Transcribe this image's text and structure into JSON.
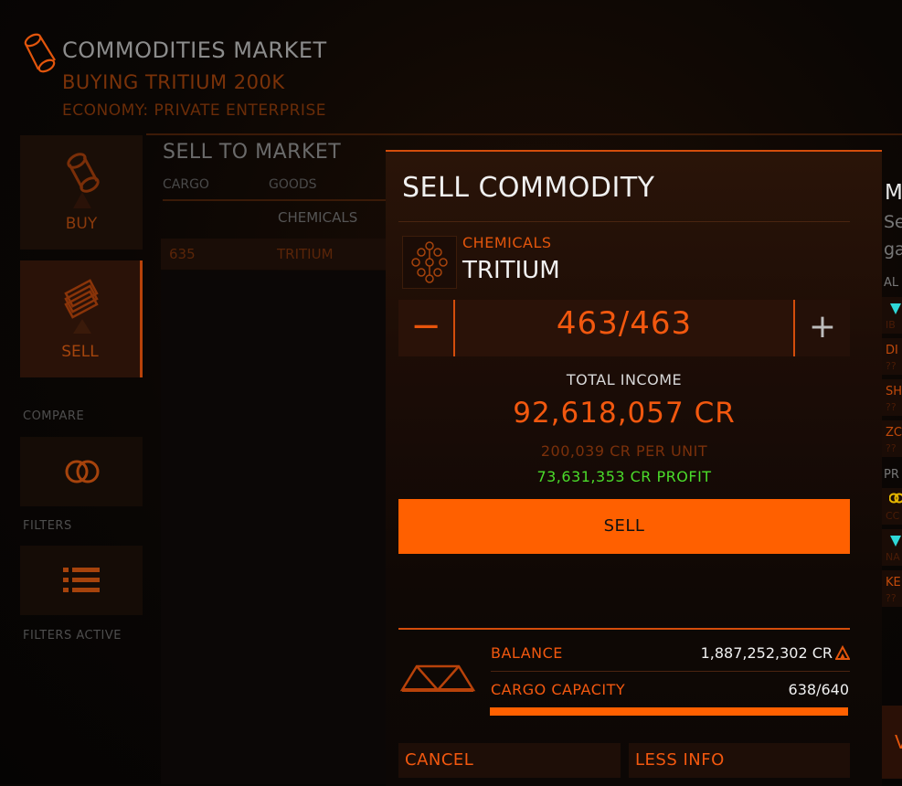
{
  "header": {
    "title": "COMMODITIES MARKET",
    "subtitle": "BUYING TRITIUM 200K",
    "economy": "ECONOMY: PRIVATE ENTERPRISE"
  },
  "nav": {
    "buy_label": "BUY",
    "sell_label": "SELL",
    "compare_caption": "COMPARE",
    "filters_caption": "FILTERS",
    "filters_active_caption": "FILTERS ACTIVE"
  },
  "market": {
    "title": "SELL TO MARKET",
    "col_cargo": "CARGO",
    "col_goods": "GOODS",
    "category": "CHEMICALS",
    "row": {
      "cargo": "635",
      "goods": "TRITIUM"
    }
  },
  "modal": {
    "title": "SELL COMMODITY",
    "category": "CHEMICALS",
    "commodity": "TRITIUM",
    "minus_label": "−",
    "plus_label": "+",
    "quantity": "463/463",
    "total_income_label": "TOTAL INCOME",
    "total_income": "92,618,057 CR",
    "per_unit": "200,039 CR PER UNIT",
    "profit": "73,631,353 CR PROFIT",
    "sell_label": "SELL",
    "balance_label": "BALANCE",
    "balance_value": "1,887,252,302 CR",
    "cargo_capacity_label": "CARGO CAPACITY",
    "cargo_capacity_value": "638/640",
    "cargo_fill": 0.997,
    "cancel_label": "CANCEL",
    "less_info_label": "LESS INFO"
  },
  "right_panel": {
    "heading": "M",
    "line1": "Se",
    "line2": "ga",
    "caption1": "AL",
    "caption2": "PR",
    "items": [
      {
        "name": "",
        "sub": "IB"
      },
      {
        "name": "DI",
        "sub": "??"
      },
      {
        "name": "SH",
        "sub": "??"
      },
      {
        "name": "ZC",
        "sub": "??"
      },
      {
        "name": "",
        "sub": "CC"
      },
      {
        "name": "",
        "sub": "NA"
      },
      {
        "name": "KE",
        "sub": "??"
      }
    ],
    "bottom_btn": "V"
  },
  "colors": {
    "accent": "#ff6000",
    "profit": "#4bdc2b",
    "text": "#efefef"
  }
}
